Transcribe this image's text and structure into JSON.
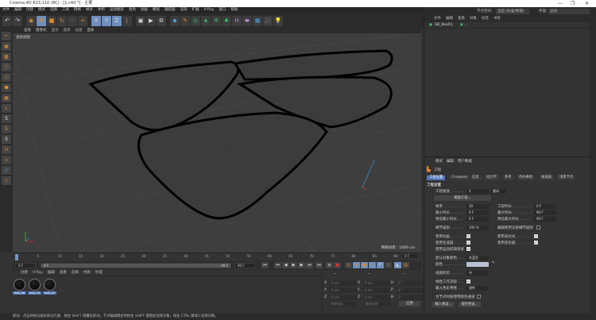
{
  "window": {
    "title": "Cinema 4D R23.110 (RC) - [1.c4d *] - 主要",
    "minimize": "—",
    "restore": "❐",
    "close": "✕"
  },
  "menu": [
    "文件",
    "编辑",
    "创建",
    "模式",
    "选择",
    "工具",
    "网格",
    "样条",
    "体积",
    "运动图形",
    "角色",
    "动画",
    "模拟",
    "跟踪器",
    "渲染",
    "扩展",
    "V-Ray",
    "窗口",
    "帮助"
  ],
  "layout": {
    "node_space_label": "节点空间:",
    "node_space_value": "当前 (标准/物理)",
    "interface_label": "界面:",
    "interface_value": "启动"
  },
  "viewport": {
    "menu": [
      "查看",
      "摄像机",
      "显示",
      "选项",
      "过滤",
      "面板"
    ],
    "label": "透视视图",
    "grid_spacing": "网格间距 : 1000 cm"
  },
  "timeline": {
    "ticks": [
      "0",
      "5",
      "10",
      "15",
      "20",
      "25",
      "30",
      "35",
      "40",
      "45",
      "50",
      "55",
      "60",
      "65",
      "70",
      "75",
      "80",
      "85",
      "90"
    ],
    "current_frame": "0 F",
    "start": "0 F",
    "range_start": "0 F",
    "range_end": "90 F",
    "end": "90 F",
    "right_frame": "0 F"
  },
  "materials": {
    "menu": [
      "创建",
      "V-Ray",
      "编辑",
      "查看",
      "选择",
      "材质",
      "纹理"
    ],
    "items": [
      "mat_06",
      "mat_18",
      "mat_22"
    ]
  },
  "coords": {
    "headers": [
      "--",
      "--",
      "--"
    ],
    "rows": [
      {
        "a": "X",
        "av": "0 cm",
        "b": "X",
        "bv": "0 cm",
        "c": "H",
        "cv": "0 °"
      },
      {
        "a": "Y",
        "av": "0 cm",
        "b": "Y",
        "bv": "0 cm",
        "c": "P",
        "cv": "0 °"
      },
      {
        "a": "Z",
        "av": "0 cm",
        "b": "Z",
        "bv": "0 cm",
        "c": "B",
        "cv": "0 °"
      }
    ],
    "mode1": "世界坐标",
    "mode2": "缩放比例",
    "apply": "应用"
  },
  "object_manager": {
    "menu": [
      "文件",
      "编辑",
      "查看",
      "对象",
      "标签",
      "书签"
    ],
    "object": "SD_Box01"
  },
  "attributes": {
    "menu": [
      "模式",
      "编辑",
      "用户数据"
    ],
    "title": "工程",
    "tabs": [
      "工程设置",
      "Cineware",
      "信息",
      "动力学",
      "参考",
      "待办事项",
      "帧插值",
      "场景节点"
    ],
    "section": "工程设置",
    "scale_label": "工程缩放 . . . . . .",
    "scale_value": "1",
    "scale_unit": "厘米",
    "scale_button": "缩放工程...",
    "fps_label": "帧率 . . . . . . . . . . .",
    "fps": "30",
    "min_label": "最小时长 . . . . . . .",
    "min": "0 F",
    "pmin_label": "预览最小时长 . . .",
    "pmin": "0 F",
    "time_label": "工程时长 . . . . . . . . .",
    "time": "0 F",
    "max_label": "最大时长 . . . . . . . . .",
    "max": "90 F",
    "pmax_label": "预览最大时长 . . . . .",
    "pmax": "90 F",
    "lod_label": "细节级别 . . . . . .",
    "lod": "100 %",
    "render_lod_label": "编辑使用渲染细节级别",
    "anim_label": "使用动画 . . . . . . .",
    "expr_label": "使用表达式 . . . . . . .",
    "gen_label": "使用生成器 . . . . . .",
    "deform_label": "使用变形器 . . . . . . .",
    "mograph_label": "使用运动剪辑系统",
    "objcolor_label": "默认对象颜色 . . .",
    "objcolor": "灰蓝色",
    "color_label": "颜色 . . . . . . . . . .",
    "color_value": "#b8c4d4",
    "clip_label": "视图修剪 . . . . . .",
    "clip": "中",
    "linear_label": "线性工作流程 . . .",
    "input_label": "输入色彩特性 . . .",
    "input": "线性",
    "vertex_label": "为节点材质使用颜色通道",
    "load_preset": "载入预设...",
    "save_preset": "保存预设..."
  },
  "status": "移动：点击并拖动鼠标移动元素。按住 SHIFT 键量化移动；节点编辑模式时按住 SHIFT 键增加选择对象；按住 CTRL 键减少选择对象。"
}
